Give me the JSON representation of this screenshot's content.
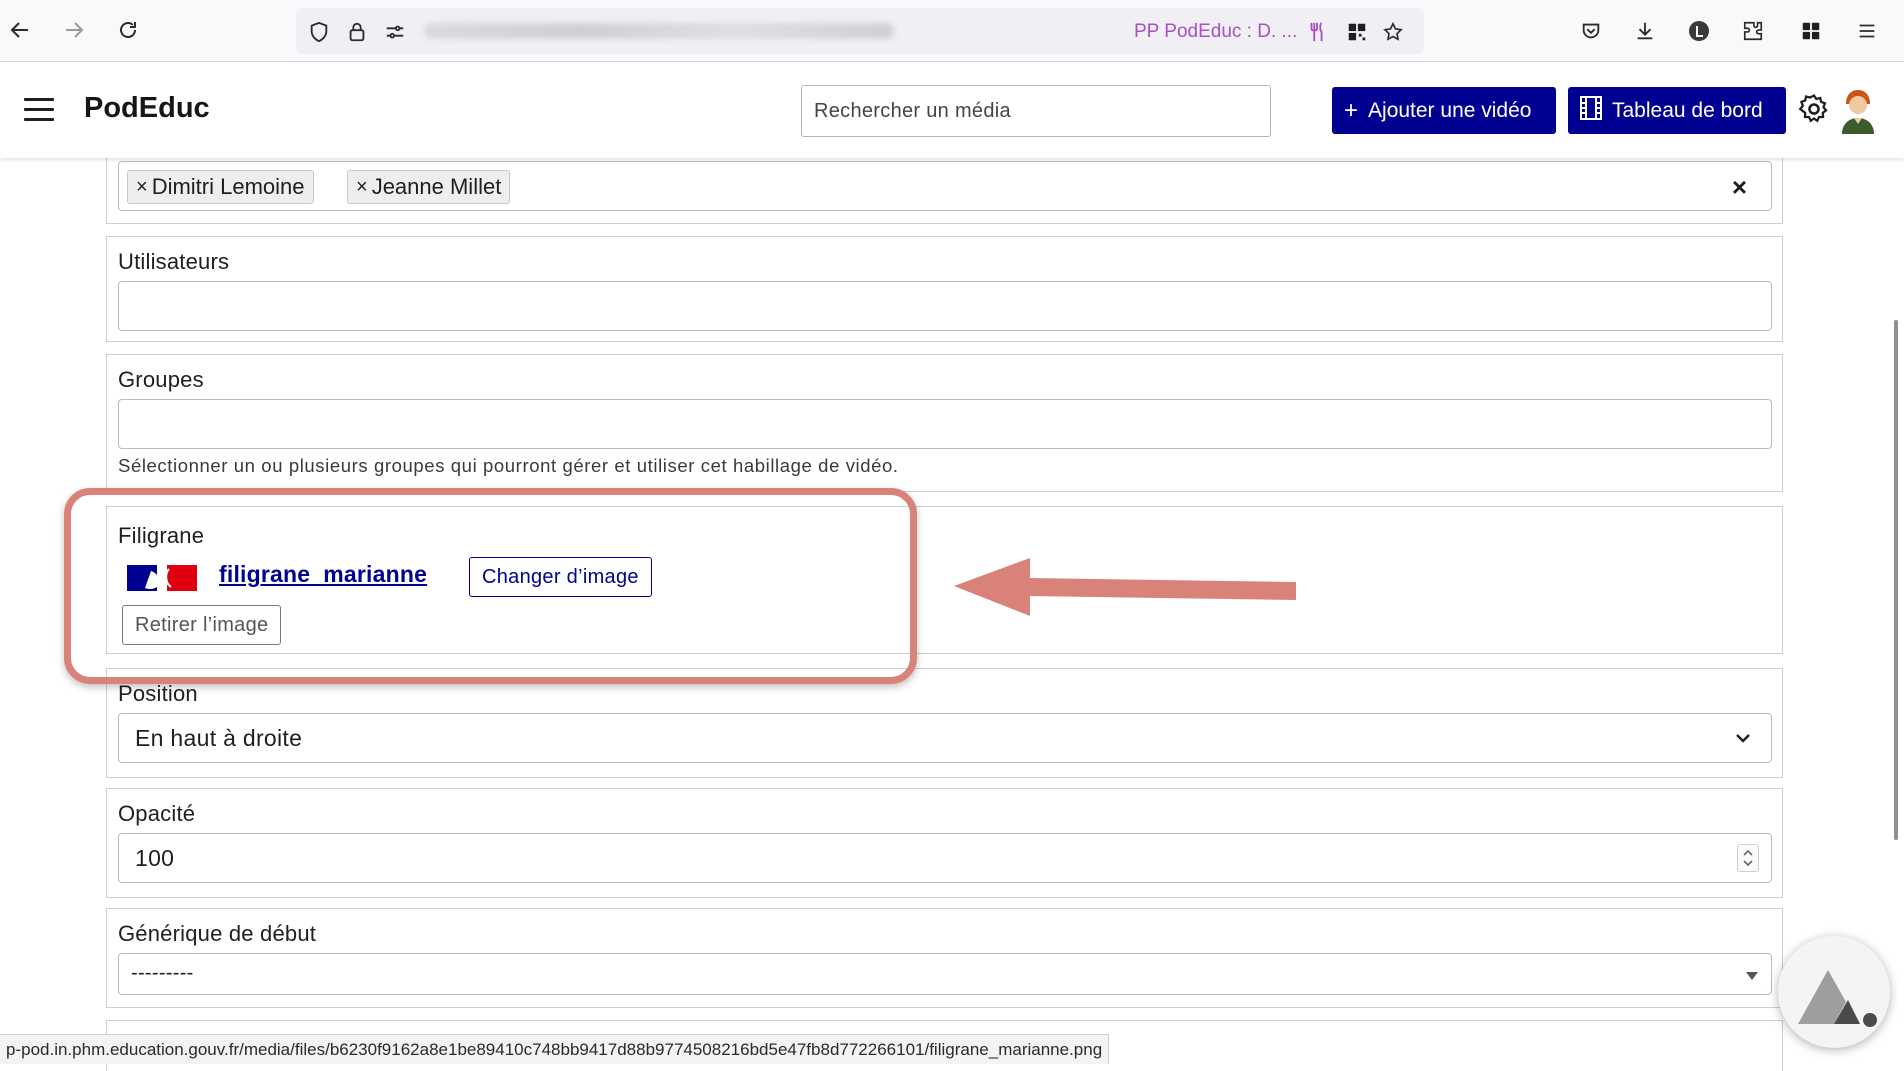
{
  "browser": {
    "tab_title": "PP PodEduc : D. ...",
    "status_url": "p-pod.in.phm.education.gouv.fr/media/files/b6230f9162a8e1be89410c748bb9417d88b9774508216bd5e47fb8d772266101/filigrane_marianne.png"
  },
  "header": {
    "brand": "PodEduc",
    "search_placeholder": "Rechercher un média",
    "add_video_label": "Ajouter une vidéo",
    "dashboard_label": "Tableau de bord"
  },
  "form": {
    "owners": {
      "chips": [
        "Dimitri Lemoine",
        "Jeanne Millet"
      ],
      "clear_symbol": "×"
    },
    "users": {
      "label": "Utilisateurs",
      "value": ""
    },
    "groups": {
      "label": "Groupes",
      "value": "",
      "help": "Sélectionner un ou plusieurs groupes qui pourront gérer et utiliser cet habillage de vidéo."
    },
    "watermark": {
      "label": "Filigrane",
      "file_name": "filigrane_marianne",
      "change_label": "Changer d’image",
      "remove_label": "Retirer l’image"
    },
    "position": {
      "label": "Position",
      "value": "En haut à droite"
    },
    "opacity": {
      "label": "Opacité",
      "value": "100"
    },
    "intro": {
      "label": "Générique de début",
      "value": "---------"
    }
  },
  "colors": {
    "primary": "#000091",
    "annotation": "#d9827a",
    "tab_title": "#a84ec8"
  }
}
